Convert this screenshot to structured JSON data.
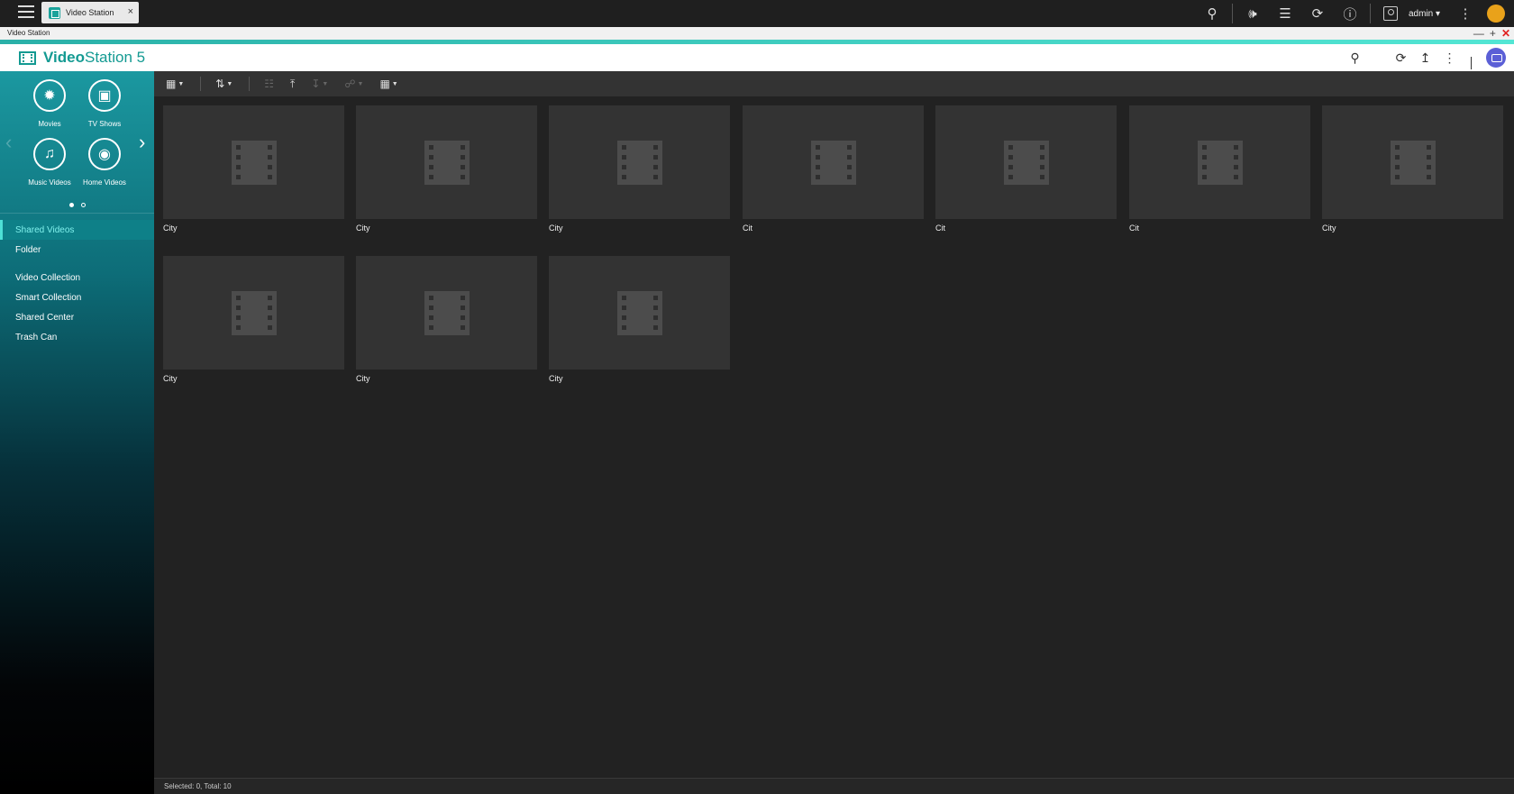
{
  "topbar": {
    "app_tab_label": "Video Station",
    "app_tab_close": "×",
    "user": "admin ▾"
  },
  "window": {
    "title": "Video Station",
    "minimize": "—",
    "maximize": "+",
    "close": "✕"
  },
  "app": {
    "logo_bold": "Video",
    "logo_rest": "Station 5"
  },
  "sidebar": {
    "categories": [
      {
        "label": "Movies",
        "icon": "film-reel-icon"
      },
      {
        "label": "TV Shows",
        "icon": "tv-icon"
      },
      {
        "label": "Music Videos",
        "icon": "music-video-icon"
      },
      {
        "label": "Home Videos",
        "icon": "camcorder-icon"
      }
    ],
    "menu": [
      {
        "label": "Shared Videos",
        "active": true
      },
      {
        "label": "Folder"
      },
      {
        "label": "Video Collection"
      },
      {
        "label": "Smart Collection"
      },
      {
        "label": "Shared Center"
      },
      {
        "label": "Trash Can"
      }
    ]
  },
  "videos": [
    {
      "title": "City"
    },
    {
      "title": "City"
    },
    {
      "title": "City"
    },
    {
      "title": "Cit"
    },
    {
      "title": "Cit"
    },
    {
      "title": "Cit"
    },
    {
      "title": "City"
    },
    {
      "title": "City"
    },
    {
      "title": "City"
    },
    {
      "title": "City"
    }
  ],
  "status": {
    "text": "Selected: 0, Total: 10"
  },
  "colors": {
    "accent": "#139a92",
    "sidebar_top": "#1b98a0",
    "active_item": "#7ff0ec",
    "chat_button": "#5b5fd6",
    "close": "#e02020"
  }
}
